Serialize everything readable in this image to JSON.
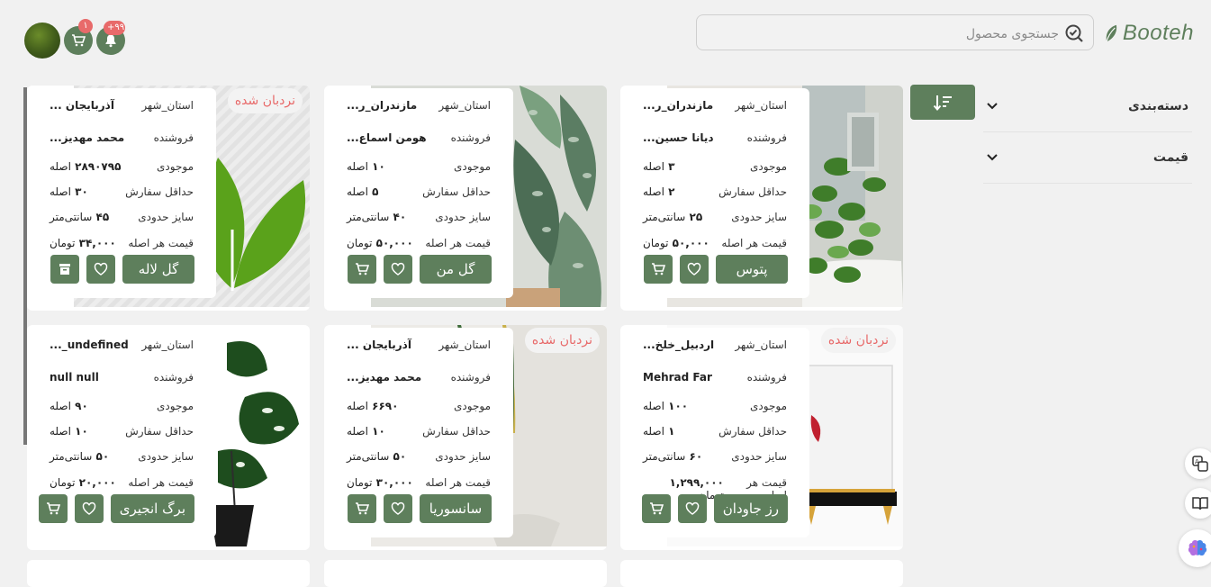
{
  "header": {
    "brand": "Booteh",
    "search_placeholder": "جستجوی محصول",
    "notif_badge": "+۹۹",
    "cart_badge": "۱"
  },
  "sidebar": {
    "filters": [
      {
        "label": "دسته‌بندی"
      },
      {
        "label": "قیمت"
      }
    ]
  },
  "labels": {
    "province": "استان_شهر",
    "seller": "فروشنده",
    "stock": "موجودی",
    "min_order": "حداقل سفارش",
    "size": "سایز حدودی",
    "price": "قیمت هر اصله",
    "ladder": "نردبان شده"
  },
  "products": [
    {
      "name": "پتوس",
      "province": "مازندران_ر...",
      "seller": "دیانا حسین...",
      "stock": "۳",
      "stock_unit": "اصله",
      "min_order": "۲",
      "min_unit": "اصله",
      "size": "۲۵",
      "size_unit": "سانتی‌متر",
      "price": "۵۰,۰۰۰",
      "price_unit": "تومان",
      "ladder": false,
      "third": "cart",
      "image": "pothos"
    },
    {
      "name": "گل من",
      "province": "مازندران_ر...",
      "seller": "هومن اسماع...",
      "stock": "۱۰",
      "stock_unit": "اصله",
      "min_order": "۵",
      "min_unit": "اصله",
      "size": "۴۰",
      "size_unit": "سانتی‌متر",
      "price": "۵۰,۰۰۰",
      "price_unit": "تومان",
      "ladder": false,
      "third": "cart",
      "image": "aglaonema"
    },
    {
      "name": "گل لاله",
      "province": "آذربایجان ...",
      "seller": "محمد مهدیز...",
      "stock": "۲۸۹۰۷۹۵",
      "stock_unit": "اصله",
      "min_order": "۳۰",
      "min_unit": "اصله",
      "size": "۴۵",
      "size_unit": "سانتی‌متر",
      "price": "۳۴,۰۰۰",
      "price_unit": "تومان",
      "ladder": true,
      "third": "archive",
      "image": "leaf"
    },
    {
      "name": "رز جاودان",
      "province": "اردبیل_خلخ...",
      "seller": "Mehrad Far",
      "stock": "۱۰۰",
      "stock_unit": "اصله",
      "min_order": "۱",
      "min_unit": "اصله",
      "size": "۶۰",
      "size_unit": "سانتی‌متر",
      "price": "۱,۲۹۹,۰۰۰",
      "price_unit": "تومان",
      "ladder": true,
      "third": "cart",
      "image": "rosebox"
    },
    {
      "name": "سانسوریا",
      "province": "آذربایجان ...",
      "seller": "محمد مهدیز...",
      "stock": "۶۶۹۰",
      "stock_unit": "اصله",
      "min_order": "۱۰",
      "min_unit": "اصله",
      "size": "۵۰",
      "size_unit": "سانتی‌متر",
      "price": "۳۰,۰۰۰",
      "price_unit": "تومان",
      "ladder": true,
      "third": "cart",
      "image": "sansevieria"
    },
    {
      "name": "برگ انجیری",
      "province": "undefined_...",
      "seller": "null null",
      "stock": "۹۰",
      "stock_unit": "اصله",
      "min_order": "۱۰",
      "min_unit": "اصله",
      "size": "۵۰",
      "size_unit": "سانتی‌متر",
      "price": "۲۰,۰۰۰",
      "price_unit": "تومان",
      "ladder": false,
      "third": "cart",
      "image": "monstera"
    }
  ],
  "colors": {
    "primary": "#5e7f5c",
    "accent_red": "#e86a6a",
    "background": "#f1f1f1"
  },
  "icons": {
    "float_1": "translate-icon",
    "float_2": "book-icon",
    "float_3": "brain-icon"
  }
}
